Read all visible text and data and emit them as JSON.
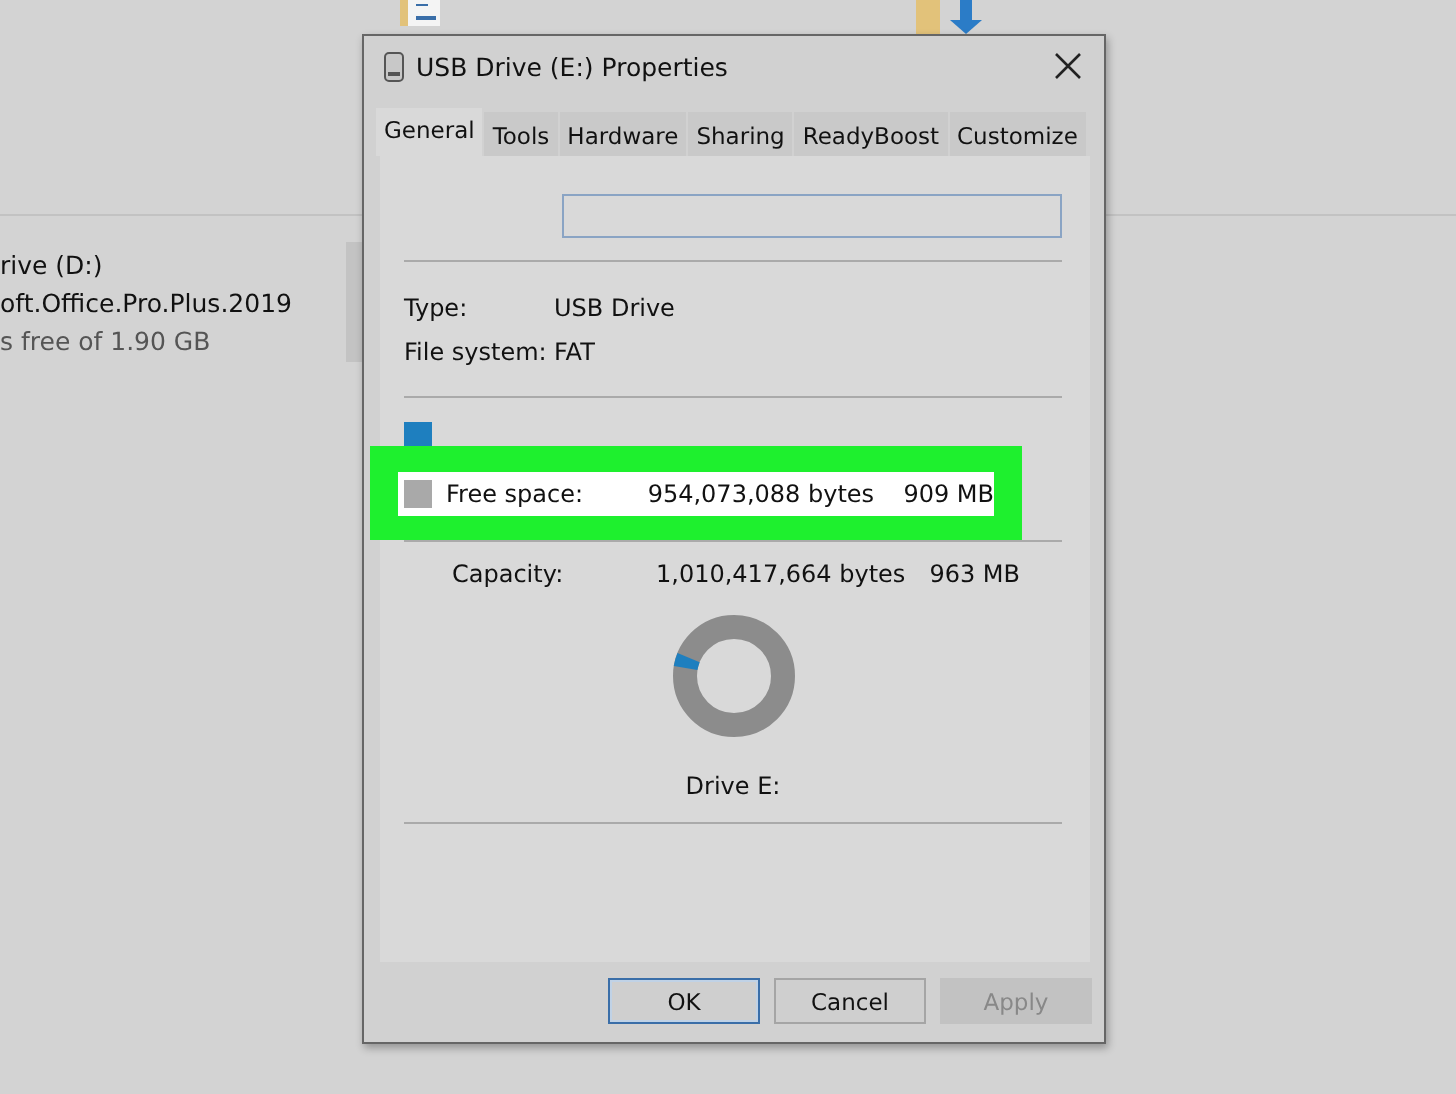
{
  "explorer": {
    "drive_name": "rive (D:)",
    "drive_label": "oft.Office.Pro.Plus.2019",
    "drive_free": "s free of 1.90 GB"
  },
  "dialog": {
    "title": "USB Drive (E:) Properties",
    "tabs": [
      {
        "label": "General",
        "selected": true
      },
      {
        "label": "Tools",
        "selected": false
      },
      {
        "label": "Hardware",
        "selected": false
      },
      {
        "label": "Sharing",
        "selected": false
      },
      {
        "label": "ReadyBoost",
        "selected": false
      },
      {
        "label": "Customize",
        "selected": false
      }
    ],
    "properties": [
      {
        "label": "Type:",
        "value": "USB Drive"
      },
      {
        "label": "File system:",
        "value": "FAT"
      }
    ],
    "free_space": {
      "label": "Free space:",
      "bytes": "954,073,088 bytes",
      "size": "909 MB",
      "highlighted": true
    },
    "capacity": {
      "label": "Capacity:",
      "bytes": "1,010,417,664 bytes",
      "size": "963 MB"
    },
    "drive_caption": "Drive E:",
    "buttons": [
      {
        "label": "OK",
        "kind": "default"
      },
      {
        "label": "Cancel",
        "kind": "normal"
      },
      {
        "label": "Apply",
        "kind": "disabled"
      }
    ]
  }
}
